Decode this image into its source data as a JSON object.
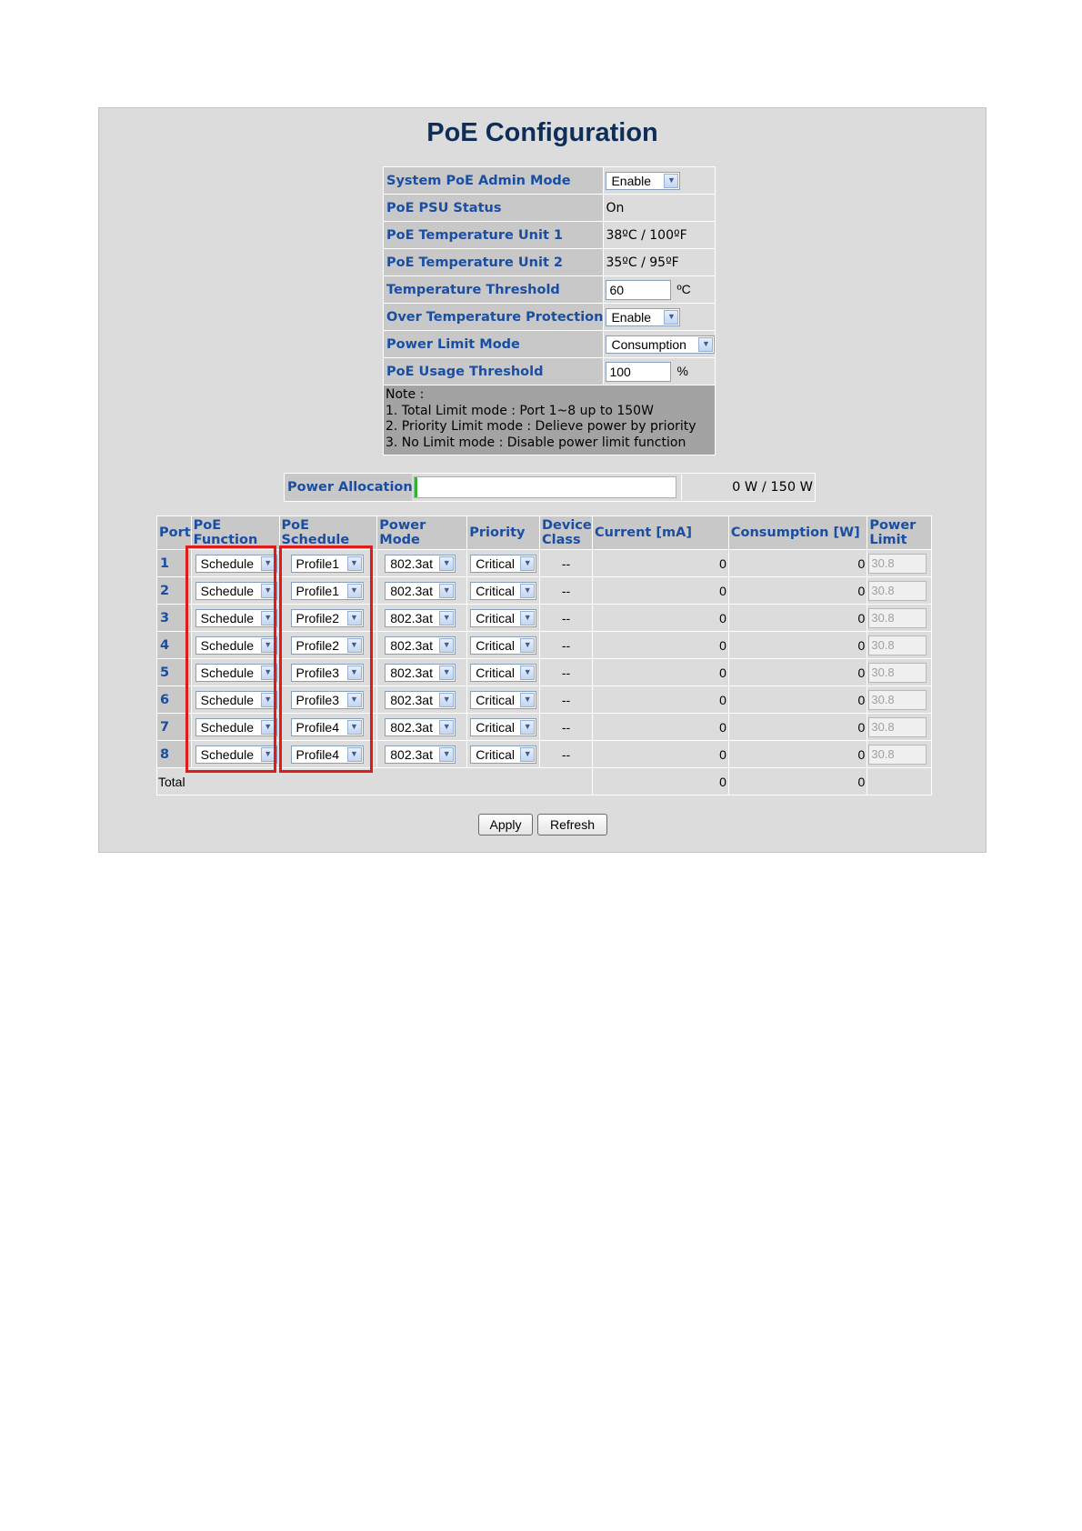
{
  "title": "PoE Configuration",
  "settings": {
    "admin_mode": {
      "label": "System PoE Admin Mode",
      "value": "Enable"
    },
    "psu_status": {
      "label": "PoE PSU Status",
      "value": "On"
    },
    "temp_unit1": {
      "label": "PoE Temperature Unit 1",
      "value": "38ºC / 100ºF"
    },
    "temp_unit2": {
      "label": "PoE Temperature Unit 2",
      "value": "35ºC / 95ºF"
    },
    "temp_threshold": {
      "label": "Temperature Threshold",
      "value": "60",
      "unit": "ºC"
    },
    "over_temp": {
      "label": "Over Temperature Protection",
      "value": "Enable"
    },
    "power_limit_mode": {
      "label": "Power Limit Mode",
      "value": "Consumption"
    },
    "usage_threshold": {
      "label": "PoE Usage Threshold",
      "value": "100",
      "unit": "%"
    },
    "note": [
      "Note :",
      "1. Total Limit mode : Port 1~8 up to 150W",
      "2. Priority Limit mode : Delieve power by priority",
      "3. No Limit mode : Disable power limit function"
    ]
  },
  "power_allocation": {
    "label": "Power Allocation",
    "value": "0 W / 150 W",
    "fill_fraction": 0.0
  },
  "ports_table": {
    "headers": {
      "port": "Port",
      "function_1": "PoE",
      "function_2": "Function",
      "schedule": "PoE Schedule",
      "power_mode": "Power Mode",
      "priority": "Priority",
      "class_1": "Device",
      "class_2": "Class",
      "current": "Current [mA]",
      "consumption": "Consumption [W]",
      "limit_1": "Power",
      "limit_2": "Limit"
    },
    "rows": [
      {
        "port": "1",
        "function": "Schedule",
        "schedule": "Profile1",
        "mode": "802.3at",
        "priority": "Critical",
        "class": "--",
        "current": "0",
        "consumption": "0",
        "limit": "30.8"
      },
      {
        "port": "2",
        "function": "Schedule",
        "schedule": "Profile1",
        "mode": "802.3at",
        "priority": "Critical",
        "class": "--",
        "current": "0",
        "consumption": "0",
        "limit": "30.8"
      },
      {
        "port": "3",
        "function": "Schedule",
        "schedule": "Profile2",
        "mode": "802.3at",
        "priority": "Critical",
        "class": "--",
        "current": "0",
        "consumption": "0",
        "limit": "30.8"
      },
      {
        "port": "4",
        "function": "Schedule",
        "schedule": "Profile2",
        "mode": "802.3at",
        "priority": "Critical",
        "class": "--",
        "current": "0",
        "consumption": "0",
        "limit": "30.8"
      },
      {
        "port": "5",
        "function": "Schedule",
        "schedule": "Profile3",
        "mode": "802.3at",
        "priority": "Critical",
        "class": "--",
        "current": "0",
        "consumption": "0",
        "limit": "30.8"
      },
      {
        "port": "6",
        "function": "Schedule",
        "schedule": "Profile3",
        "mode": "802.3at",
        "priority": "Critical",
        "class": "--",
        "current": "0",
        "consumption": "0",
        "limit": "30.8"
      },
      {
        "port": "7",
        "function": "Schedule",
        "schedule": "Profile4",
        "mode": "802.3at",
        "priority": "Critical",
        "class": "--",
        "current": "0",
        "consumption": "0",
        "limit": "30.8"
      },
      {
        "port": "8",
        "function": "Schedule",
        "schedule": "Profile4",
        "mode": "802.3at",
        "priority": "Critical",
        "class": "--",
        "current": "0",
        "consumption": "0",
        "limit": "30.8"
      }
    ],
    "total": {
      "label": "Total",
      "current": "0",
      "consumption": "0"
    }
  },
  "buttons": {
    "apply": "Apply",
    "refresh": "Refresh"
  },
  "icons": {
    "dropdown": "chevron-down-icon"
  },
  "colors": {
    "label_blue": "#1a4ea2",
    "title_navy": "#0f2e57",
    "highlight_red": "#e01b1b",
    "bar_green": "#2fb52f"
  }
}
